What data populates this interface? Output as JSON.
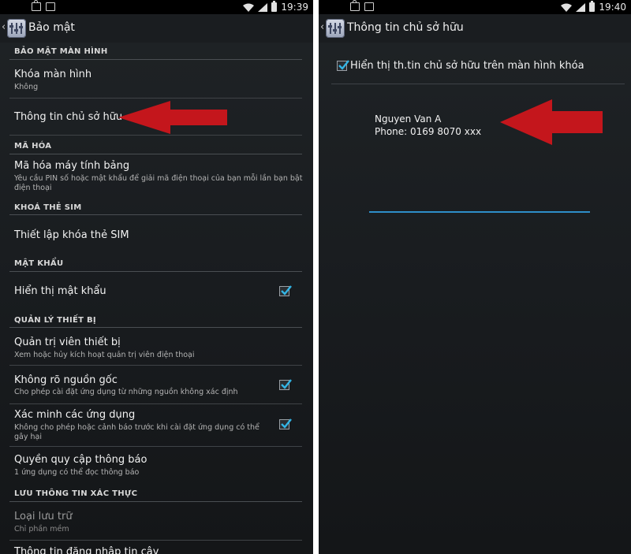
{
  "left_screen": {
    "status_time": "19:39",
    "title": "Bảo mật",
    "sections": {
      "screen_security": "BẢO MẬT MÀN HÌNH",
      "encryption": "MÃ HÓA",
      "sim_lock": "KHOÁ THẺ SIM",
      "passwords": "MẬT KHẨU",
      "device_admin": "QUẢN LÝ THIẾT BỊ",
      "credential_storage": "LƯU THÔNG TIN XÁC THỰC"
    },
    "items": {
      "screen_lock_title": "Khóa màn hình",
      "screen_lock_sub": "Không",
      "owner_info_title": "Thông tin chủ sở hữu",
      "encrypt_title": "Mã hóa máy tính bảng",
      "encrypt_sub_1": "Yêu cầu PIN số hoặc mật khẩu để giải mã điện thoại của bạn mỗi lần bạn bật",
      "encrypt_sub_2": "điện thoại",
      "sim_lock_title": "Thiết lập khóa thẻ SIM",
      "show_password_title": "Hiển thị mật khẩu",
      "device_admins_title": "Quản trị viên thiết bị",
      "device_admins_sub": "Xem hoặc hủy kích hoạt quản trị viên điện thoại",
      "unknown_sources_title": "Không rõ nguồn gốc",
      "unknown_sources_sub": "Cho phép cài đặt ứng dụng từ những nguồn không xác định",
      "verify_apps_title": "Xác minh các ứng dụng",
      "verify_apps_sub_1": "Không cho phép hoặc cảnh báo trước khi cài đặt ứng dụng có thể",
      "verify_apps_sub_2": "gây hại",
      "notification_access_title": "Quyền quy cập thông báo",
      "notification_access_sub": "1 ứng dụng có thể đọc thông báo",
      "storage_type_title": "Loại lưu trữ",
      "storage_type_sub": "Chỉ phần mềm",
      "trusted_credentials_title": "Thông tin đăng nhập tin cậy"
    },
    "checks": {
      "show_password": true,
      "unknown_sources": true,
      "verify_apps": true
    }
  },
  "right_screen": {
    "status_time": "19:40",
    "title": "Thông tin chủ sở hữu",
    "show_on_lock_label": "Hiển thị th.tin chủ sở hữu trên màn hình khóa",
    "show_on_lock_checked": true,
    "owner_line_1": "Nguyen Van A",
    "owner_line_2": "Phone: 0169 8070 xxx"
  },
  "colors": {
    "accent": "#2e8ec9",
    "check": "#33b5e5",
    "annotation_arrow": "#c4161c"
  }
}
